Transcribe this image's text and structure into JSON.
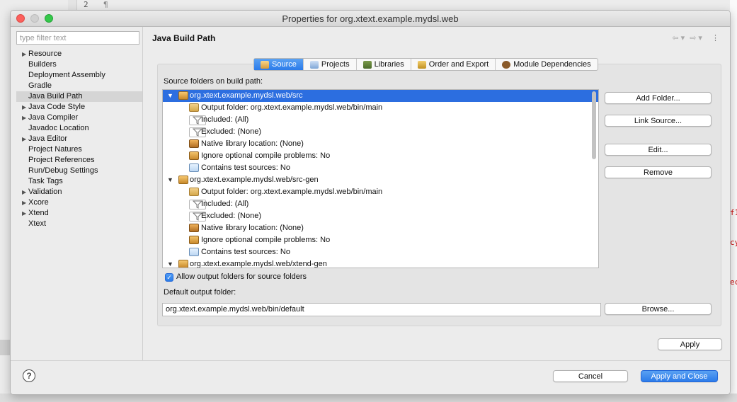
{
  "background": {
    "line_number": "2",
    "pilcrow": "¶",
    "red_fragments": [
      "f1",
      "cy",
      "ec"
    ]
  },
  "window": {
    "title": "Properties for org.xtext.example.mydsl.web"
  },
  "sidebar": {
    "filter_placeholder": "type filter text",
    "items": [
      {
        "label": "Resource",
        "expandable": true
      },
      {
        "label": "Builders",
        "expandable": false
      },
      {
        "label": "Deployment Assembly",
        "expandable": false
      },
      {
        "label": "Gradle",
        "expandable": false
      },
      {
        "label": "Java Build Path",
        "expandable": false,
        "selected": true
      },
      {
        "label": "Java Code Style",
        "expandable": true
      },
      {
        "label": "Java Compiler",
        "expandable": true
      },
      {
        "label": "Javadoc Location",
        "expandable": false
      },
      {
        "label": "Java Editor",
        "expandable": true
      },
      {
        "label": "Project Natures",
        "expandable": false
      },
      {
        "label": "Project References",
        "expandable": false
      },
      {
        "label": "Run/Debug Settings",
        "expandable": false
      },
      {
        "label": "Task Tags",
        "expandable": false
      },
      {
        "label": "Validation",
        "expandable": true
      },
      {
        "label": "Xcore",
        "expandable": true
      },
      {
        "label": "Xtend",
        "expandable": true
      },
      {
        "label": "Xtext",
        "expandable": false
      }
    ]
  },
  "page": {
    "title": "Java Build Path",
    "nav": {
      "back": "⇦",
      "back_menu": "▾",
      "forward": "⇨",
      "forward_menu": "▾",
      "more": "⋮"
    }
  },
  "tabs": [
    {
      "label": "Source",
      "active": true
    },
    {
      "label": "Projects",
      "active": false
    },
    {
      "label": "Libraries",
      "active": false
    },
    {
      "label": "Order and Export",
      "active": false
    },
    {
      "label": "Module Dependencies",
      "active": false
    }
  ],
  "source": {
    "label": "Source folders on build path:",
    "tree": [
      {
        "level": 0,
        "expanded": true,
        "icon": "package-folder",
        "text": "org.xtext.example.mydsl.web/src",
        "selected": true
      },
      {
        "level": 1,
        "icon": "output-folder",
        "text": "Output folder: org.xtext.example.mydsl.web/bin/main"
      },
      {
        "level": 1,
        "icon": "filter",
        "text": "Included: (All)"
      },
      {
        "level": 1,
        "icon": "filter",
        "text": "Excluded: (None)"
      },
      {
        "level": 1,
        "icon": "native-library",
        "text": "Native library location: (None)"
      },
      {
        "level": 1,
        "icon": "ignore-problems",
        "text": "Ignore optional compile problems: No"
      },
      {
        "level": 1,
        "icon": "test-sources",
        "text": "Contains test sources: No"
      },
      {
        "level": 0,
        "expanded": true,
        "icon": "package-folder",
        "text": "org.xtext.example.mydsl.web/src-gen"
      },
      {
        "level": 1,
        "icon": "output-folder",
        "text": "Output folder: org.xtext.example.mydsl.web/bin/main"
      },
      {
        "level": 1,
        "icon": "filter",
        "text": "Included: (All)"
      },
      {
        "level": 1,
        "icon": "filter",
        "text": "Excluded: (None)"
      },
      {
        "level": 1,
        "icon": "native-library",
        "text": "Native library location: (None)"
      },
      {
        "level": 1,
        "icon": "ignore-problems",
        "text": "Ignore optional compile problems: No"
      },
      {
        "level": 1,
        "icon": "test-sources",
        "text": "Contains test sources: No"
      },
      {
        "level": 0,
        "expanded": true,
        "icon": "package-folder",
        "text": "org.xtext.example.mydsl.web/xtend-gen"
      }
    ],
    "buttons": {
      "add_folder": "Add Folder...",
      "link_source": "Link Source...",
      "edit": "Edit...",
      "remove": "Remove"
    },
    "allow_output_folders": {
      "label": "Allow output folders for source folders",
      "checked": true
    },
    "default_output_label": "Default output folder:",
    "default_output_value": "org.xtext.example.mydsl.web/bin/default",
    "browse": "Browse..."
  },
  "footer": {
    "apply": "Apply",
    "cancel": "Cancel",
    "apply_and_close": "Apply and Close",
    "help": "?"
  },
  "colors": {
    "accent": "#2b7bea",
    "selection": "#2c6ee0"
  }
}
